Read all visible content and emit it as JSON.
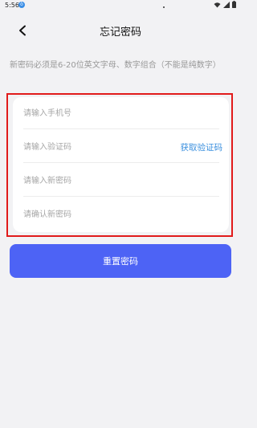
{
  "status_bar": {
    "time": "5:56",
    "notification_badge": "ò"
  },
  "header": {
    "title": "忘记密码"
  },
  "hint_text": "新密码必须是6-20位英文字母、数字组合（不能是纯数字）",
  "form": {
    "phone_placeholder": "请输入手机号",
    "code_placeholder": "请输入验证码",
    "get_code_label": "获取验证码",
    "new_password_placeholder": "请输入新密码",
    "confirm_password_placeholder": "请确认新密码"
  },
  "actions": {
    "reset_label": "重置密码"
  },
  "colors": {
    "primary_button": "#4d63f5",
    "link": "#3a8fde",
    "highlight_border": "#e11b1b",
    "background": "#f2f2f4"
  }
}
